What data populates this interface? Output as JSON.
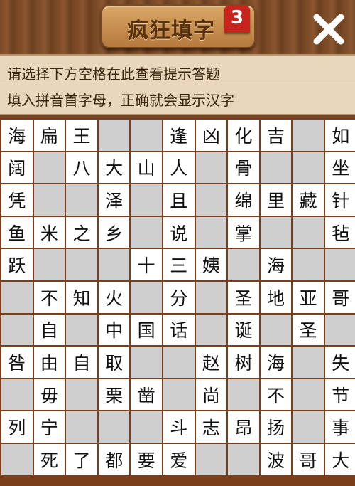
{
  "header": {
    "title": "疯狂填字",
    "level": "3",
    "close_icon": "close-x-icon",
    "colors": {
      "wood": "#7a4a26",
      "badge": "#c8231c",
      "plaque": "#d9a766"
    }
  },
  "hint": {
    "line1": "请选择下方空格在此查看提示答题",
    "line2": "填入拼音首字母，正确就会显示汉字"
  },
  "board": {
    "rows": [
      [
        "海",
        "扁",
        "王",
        "",
        "",
        "逢",
        "凶",
        "化",
        "吉",
        "",
        "如"
      ],
      [
        "阔",
        "",
        "八",
        "大",
        "山",
        "人",
        "",
        "骨",
        "",
        "",
        "坐"
      ],
      [
        "凭",
        "",
        "",
        "泽",
        "",
        "且",
        "",
        "绵",
        "里",
        "藏",
        "针"
      ],
      [
        "鱼",
        "米",
        "之",
        "乡",
        "",
        "说",
        "",
        "掌",
        "",
        "",
        "毡"
      ],
      [
        "跃",
        "",
        "",
        "",
        "十",
        "三",
        "姨",
        "",
        "海",
        "",
        ""
      ],
      [
        "",
        "不",
        "知",
        "火",
        "",
        "分",
        "",
        "圣",
        "地",
        "亚",
        "哥"
      ],
      [
        "",
        "自",
        "",
        "中",
        "国",
        "话",
        "",
        "诞",
        "",
        "圣",
        ""
      ],
      [
        "咎",
        "由",
        "自",
        "取",
        "",
        "",
        "赵",
        "树",
        "海",
        "",
        "失"
      ],
      [
        "",
        "毋",
        "",
        "栗",
        "凿",
        "",
        "尚",
        "",
        "不",
        "",
        "节"
      ],
      [
        "列",
        "宁",
        "",
        "",
        "",
        "斗",
        "志",
        "昂",
        "扬",
        "",
        "事"
      ],
      [
        "",
        "死",
        "了",
        "都",
        "要",
        "爱",
        "",
        "",
        "波",
        "哥",
        "大"
      ]
    ]
  }
}
